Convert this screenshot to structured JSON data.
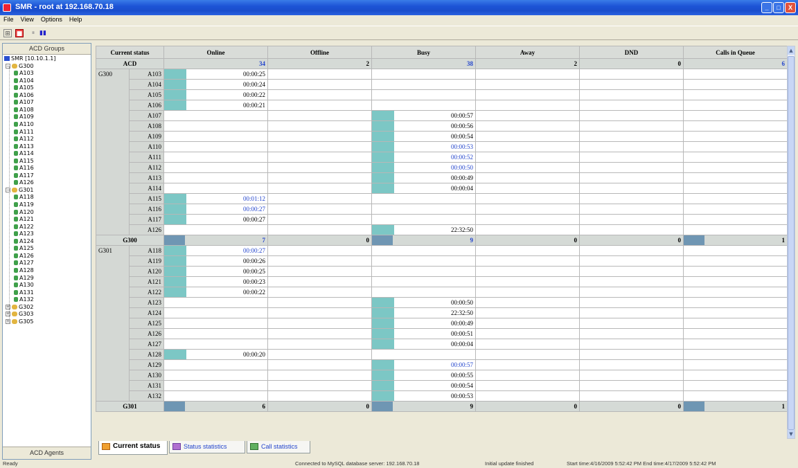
{
  "window": {
    "title": "SMR - root at 192.168.70.18",
    "controls": [
      "_",
      "□",
      "X"
    ]
  },
  "menu": [
    "File",
    "View",
    "Options",
    "Help"
  ],
  "toolbar": {
    "buttons": [
      "expand-icon",
      "stop-icon",
      "pause-icon",
      "bars-icon"
    ]
  },
  "left": {
    "header": "ACD Groups",
    "footer": "ACD Agents",
    "tree": [
      {
        "label": "SMR [10.10.1.1]",
        "level": 0,
        "kind": "root"
      },
      {
        "label": "G300",
        "level": 1,
        "kind": "group",
        "exp": "-"
      },
      {
        "label": "A103",
        "level": 2,
        "kind": "agent"
      },
      {
        "label": "A104",
        "level": 2,
        "kind": "agent"
      },
      {
        "label": "A105",
        "level": 2,
        "kind": "agent"
      },
      {
        "label": "A106",
        "level": 2,
        "kind": "agent"
      },
      {
        "label": "A107",
        "level": 2,
        "kind": "agent"
      },
      {
        "label": "A108",
        "level": 2,
        "kind": "agent"
      },
      {
        "label": "A109",
        "level": 2,
        "kind": "agent"
      },
      {
        "label": "A110",
        "level": 2,
        "kind": "agent"
      },
      {
        "label": "A111",
        "level": 2,
        "kind": "agent"
      },
      {
        "label": "A112",
        "level": 2,
        "kind": "agent"
      },
      {
        "label": "A113",
        "level": 2,
        "kind": "agent"
      },
      {
        "label": "A114",
        "level": 2,
        "kind": "agent"
      },
      {
        "label": "A115",
        "level": 2,
        "kind": "agent"
      },
      {
        "label": "A116",
        "level": 2,
        "kind": "agent"
      },
      {
        "label": "A117",
        "level": 2,
        "kind": "agent"
      },
      {
        "label": "A126",
        "level": 2,
        "kind": "agent"
      },
      {
        "label": "G301",
        "level": 1,
        "kind": "group",
        "exp": "-"
      },
      {
        "label": "A118",
        "level": 2,
        "kind": "agent"
      },
      {
        "label": "A119",
        "level": 2,
        "kind": "agent"
      },
      {
        "label": "A120",
        "level": 2,
        "kind": "agent"
      },
      {
        "label": "A121",
        "level": 2,
        "kind": "agent"
      },
      {
        "label": "A122",
        "level": 2,
        "kind": "agent"
      },
      {
        "label": "A123",
        "level": 2,
        "kind": "agent"
      },
      {
        "label": "A124",
        "level": 2,
        "kind": "agent"
      },
      {
        "label": "A125",
        "level": 2,
        "kind": "agent"
      },
      {
        "label": "A126",
        "level": 2,
        "kind": "agent"
      },
      {
        "label": "A127",
        "level": 2,
        "kind": "agent"
      },
      {
        "label": "A128",
        "level": 2,
        "kind": "agent"
      },
      {
        "label": "A129",
        "level": 2,
        "kind": "agent"
      },
      {
        "label": "A130",
        "level": 2,
        "kind": "agent"
      },
      {
        "label": "A131",
        "level": 2,
        "kind": "agent"
      },
      {
        "label": "A132",
        "level": 2,
        "kind": "agent"
      },
      {
        "label": "G302",
        "level": 1,
        "kind": "group",
        "exp": "+"
      },
      {
        "label": "G303",
        "level": 1,
        "kind": "group",
        "exp": "+"
      },
      {
        "label": "G305",
        "level": 1,
        "kind": "group",
        "exp": "+"
      }
    ]
  },
  "table": {
    "columns": [
      "Current status",
      "Online",
      "Offline",
      "Busy",
      "Away",
      "DND",
      "Calls in Queue"
    ],
    "acd": {
      "label": "ACD",
      "online": "34",
      "offline": "2",
      "busy": "38",
      "away": "2",
      "dnd": "0",
      "queue": "6"
    },
    "groups": [
      {
        "name": "G300",
        "rows": [
          {
            "agent": "A103",
            "online": "00:00:25"
          },
          {
            "agent": "A104",
            "online": "00:00:24"
          },
          {
            "agent": "A105",
            "online": "00:00:22"
          },
          {
            "agent": "A106",
            "online": "00:00:21"
          },
          {
            "agent": "A107",
            "busy": "00:00:57"
          },
          {
            "agent": "A108",
            "busy": "00:00:56"
          },
          {
            "agent": "A109",
            "busy": "00:00:54"
          },
          {
            "agent": "A110",
            "busy": "00:00:53",
            "blue": true
          },
          {
            "agent": "A111",
            "busy": "00:00:52",
            "blue": true
          },
          {
            "agent": "A112",
            "busy": "00:00:50",
            "blue": true
          },
          {
            "agent": "A113",
            "busy": "00:00:49"
          },
          {
            "agent": "A114",
            "busy": "00:00:04"
          },
          {
            "agent": "A115",
            "online": "00:01:12",
            "blue": true
          },
          {
            "agent": "A116",
            "online": "00:00:27",
            "blue": true
          },
          {
            "agent": "A117",
            "online": "00:00:27"
          },
          {
            "agent": "A126",
            "busy": "22:32:50"
          }
        ],
        "total": {
          "online": "7",
          "offline": "0",
          "busy": "9",
          "away": "0",
          "dnd": "0",
          "queue": "1"
        }
      },
      {
        "name": "G301",
        "rows": [
          {
            "agent": "A118",
            "online": "00:00:27",
            "blue": true
          },
          {
            "agent": "A119",
            "online": "00:00:26"
          },
          {
            "agent": "A120",
            "online": "00:00:25"
          },
          {
            "agent": "A121",
            "online": "00:00:23"
          },
          {
            "agent": "A122",
            "online": "00:00:22"
          },
          {
            "agent": "A123",
            "busy": "00:00:50"
          },
          {
            "agent": "A124",
            "busy": "22:32:50"
          },
          {
            "agent": "A125",
            "busy": "00:00:49"
          },
          {
            "agent": "A126",
            "busy": "00:00:51"
          },
          {
            "agent": "A127",
            "busy": "00:00:04"
          },
          {
            "agent": "A128",
            "online": "00:00:20"
          },
          {
            "agent": "A129",
            "busy": "00:00:57",
            "blue": true
          },
          {
            "agent": "A130",
            "busy": "00:00:55"
          },
          {
            "agent": "A131",
            "busy": "00:00:54"
          },
          {
            "agent": "A132",
            "busy": "00:00:53"
          }
        ],
        "total": {
          "online": "6",
          "offline": "0",
          "busy": "9",
          "away": "0",
          "dnd": "0",
          "queue": "1"
        }
      }
    ]
  },
  "tabs": [
    {
      "label": "Current status",
      "active": true
    },
    {
      "label": "Status statistics",
      "active": false
    },
    {
      "label": "Call statistics",
      "active": false
    }
  ],
  "status": {
    "left": "Ready",
    "db": "Connected to MySQL database server: 192.168.70.18",
    "update": "Initial update finished",
    "time": "Start time:4/16/2009 5:52:42 PM  End time:4/17/2009 5:52:42 PM"
  },
  "colors": {
    "online_bar": "#7cc7c5",
    "group_bar": "#6f96b3",
    "highlight_text": "#2244cc"
  }
}
